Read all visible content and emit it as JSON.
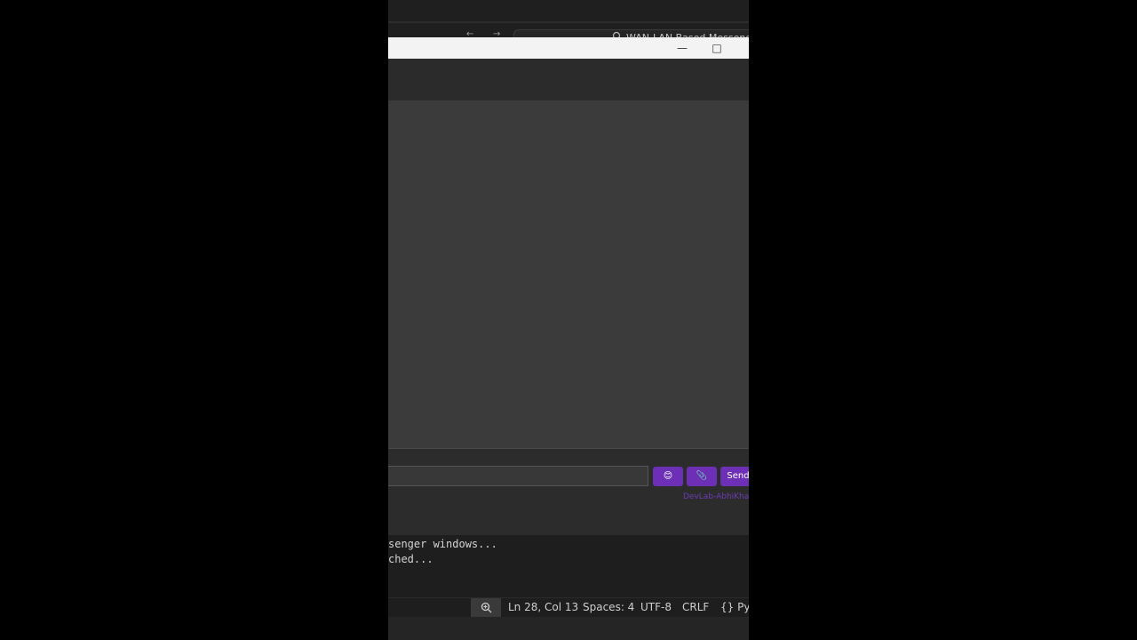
{
  "ide": {
    "nav_back": "←",
    "nav_forward": "→",
    "command_center": {
      "search_icon": "search-icon",
      "title": "WAN-LAN Based Messenger"
    }
  },
  "app_window": {
    "minimize_glyph": "—",
    "maximize_glyph": "□"
  },
  "chat": {
    "message_input": {
      "value": "",
      "placeholder": ""
    },
    "emoji_button": "😊",
    "attach_button": "📎",
    "send_button": "Send",
    "credit": "DevLab-AbhiKhan"
  },
  "terminal": {
    "lines": [
      "senger windows...",
      "ched..."
    ]
  },
  "statusbar": {
    "zoom_icon": "zoom-in-icon",
    "position": "Ln 28, Col 13",
    "spaces": "Spaces: 4",
    "encoding": "UTF-8",
    "eol": "CRLF",
    "language": "{} Py"
  },
  "colors": {
    "accent": "#6d2fb6",
    "credit": "#6c3bb5"
  }
}
